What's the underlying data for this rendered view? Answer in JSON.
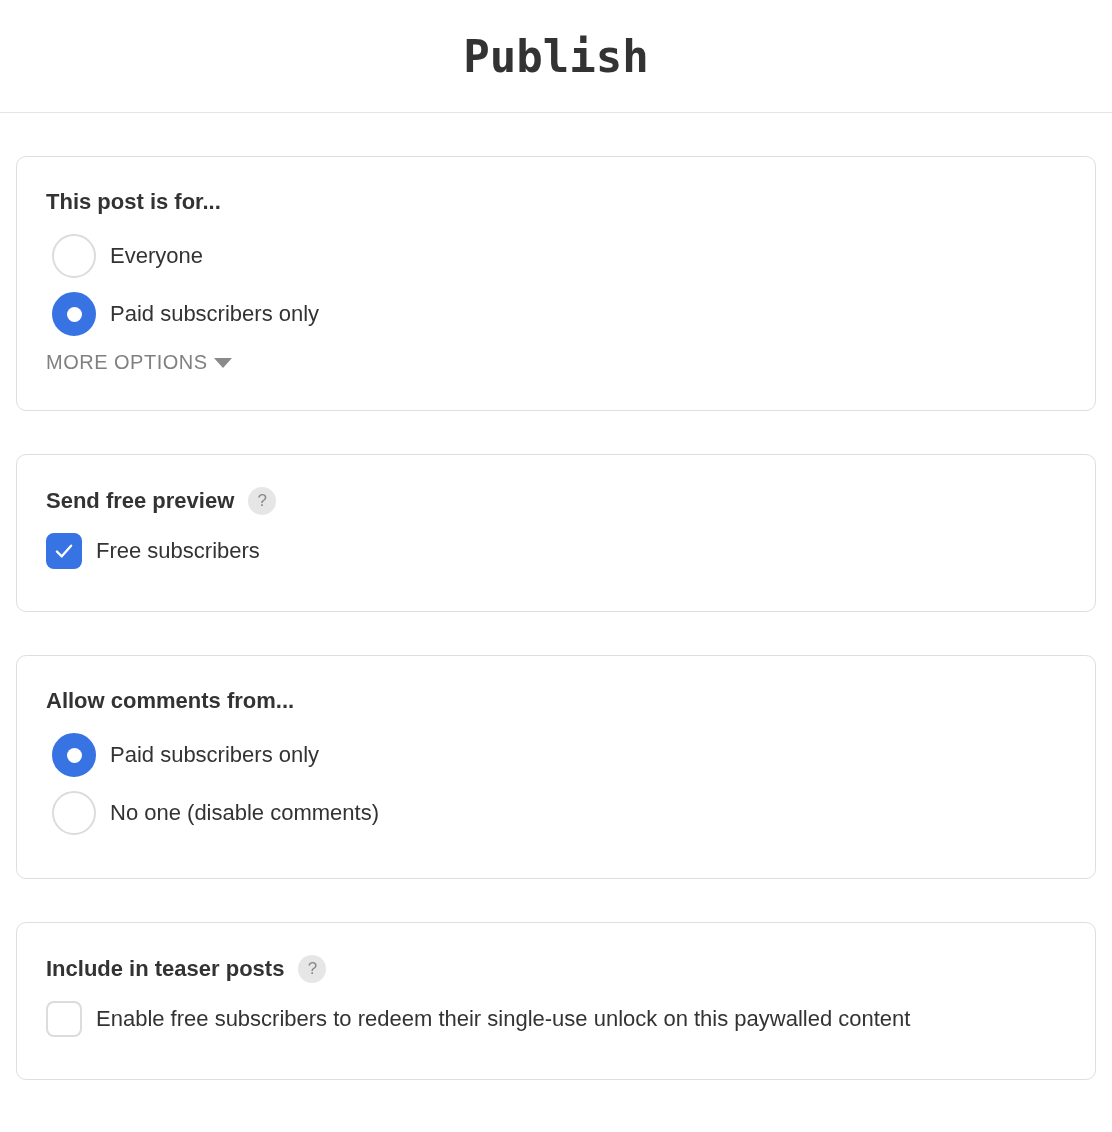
{
  "header": {
    "title": "Publish"
  },
  "sections": [
    {
      "kind": "radio",
      "title": "This post is for...",
      "options": [
        {
          "label": "Everyone",
          "selected": false
        },
        {
          "label": "Paid subscribers only",
          "selected": true
        }
      ],
      "more_options": "MORE OPTIONS"
    },
    {
      "kind": "checkbox",
      "title": "Send free preview",
      "help": "?",
      "options": [
        {
          "label": "Free subscribers",
          "checked": true
        }
      ]
    },
    {
      "kind": "radio",
      "title": "Allow comments from...",
      "options": [
        {
          "label": "Paid subscribers only",
          "selected": true
        },
        {
          "label": "No one (disable comments)",
          "selected": false
        }
      ]
    },
    {
      "kind": "checkbox",
      "title": "Include in teaser posts",
      "help": "?",
      "options": [
        {
          "label": "Enable free subscribers to redeem their single-use unlock on this paywalled content",
          "checked": false
        }
      ]
    }
  ]
}
